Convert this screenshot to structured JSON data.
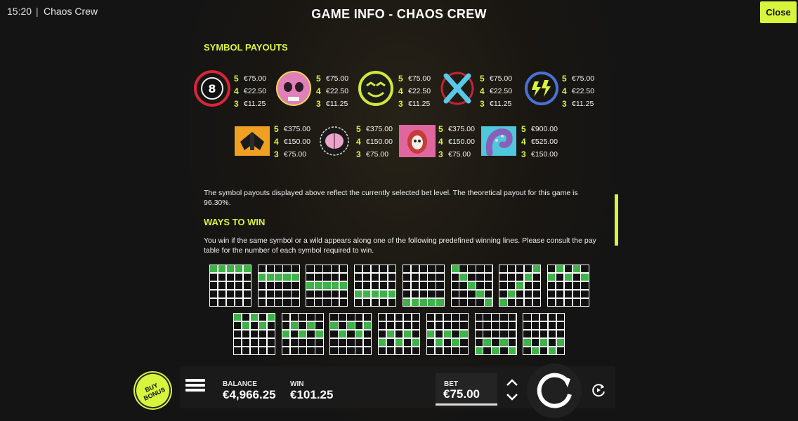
{
  "status": {
    "time": "15:20",
    "separator": "|",
    "app_name": "Chaos Crew"
  },
  "header": {
    "title": "GAME INFO - CHAOS CREW",
    "close_label": "Close"
  },
  "symbol_payouts": {
    "heading": "SYMBOL PAYOUTS",
    "row1": [
      {
        "icon": "record-disc-icon",
        "pays": [
          [
            "5",
            "€75.00"
          ],
          [
            "4",
            "€22.50"
          ],
          [
            "3",
            "€11.25"
          ]
        ]
      },
      {
        "icon": "pink-skull-icon",
        "pays": [
          [
            "5",
            "€75.00"
          ],
          [
            "4",
            "€22.50"
          ],
          [
            "3",
            "€11.25"
          ]
        ]
      },
      {
        "icon": "green-face-icon",
        "pays": [
          [
            "5",
            "€75.00"
          ],
          [
            "4",
            "€22.50"
          ],
          [
            "3",
            "€11.25"
          ]
        ]
      },
      {
        "icon": "blue-x-icon",
        "pays": [
          [
            "5",
            "€75.00"
          ],
          [
            "4",
            "€22.50"
          ],
          [
            "3",
            "€11.25"
          ]
        ]
      },
      {
        "icon": "lightning-icon",
        "pays": [
          [
            "5",
            "€75.00"
          ],
          [
            "4",
            "€22.50"
          ],
          [
            "3",
            "€11.25"
          ]
        ]
      }
    ],
    "row2": [
      {
        "icon": "moth-icon",
        "pays": [
          [
            "5",
            "€375.00"
          ],
          [
            "4",
            "€150.00"
          ],
          [
            "3",
            "€75.00"
          ]
        ]
      },
      {
        "icon": "brain-icon",
        "pays": [
          [
            "5",
            "€375.00"
          ],
          [
            "4",
            "€150.00"
          ],
          [
            "3",
            "€75.00"
          ]
        ]
      },
      {
        "icon": "apple-skull-icon",
        "pays": [
          [
            "5",
            "€375.00"
          ],
          [
            "4",
            "€150.00"
          ],
          [
            "3",
            "€75.00"
          ]
        ]
      },
      {
        "icon": "tentacle-icon",
        "pays": [
          [
            "5",
            "€900.00"
          ],
          [
            "4",
            "€525.00"
          ],
          [
            "3",
            "€150.00"
          ]
        ]
      }
    ],
    "note": "The symbol payouts displayed above reflect the currently selected bet level. The theoretical payout for this game is 96.30%."
  },
  "ways_to_win": {
    "heading": "WAYS TO WIN",
    "text": "You win if the same symbol or a wild appears along one of the following predefined winning lines. Please consult the pay table for the number of each symbol required to win.",
    "lines": [
      [
        0,
        0,
        0,
        0,
        0
      ],
      [
        1,
        1,
        1,
        1,
        1
      ],
      [
        2,
        2,
        2,
        2,
        2
      ],
      [
        3,
        3,
        3,
        3,
        3
      ],
      [
        4,
        4,
        4,
        4,
        4
      ],
      [
        0,
        1,
        2,
        3,
        4
      ],
      [
        4,
        3,
        2,
        1,
        0
      ],
      [
        1,
        0,
        1,
        0,
        1
      ],
      [
        0,
        1,
        0,
        1,
        0
      ],
      [
        2,
        1,
        2,
        1,
        2
      ],
      [
        1,
        2,
        1,
        2,
        1
      ],
      [
        3,
        2,
        3,
        2,
        3
      ],
      [
        2,
        3,
        2,
        3,
        2
      ],
      [
        4,
        3,
        4,
        3,
        4
      ],
      [
        3,
        4,
        3,
        4,
        3
      ]
    ]
  },
  "bottom": {
    "buy_bonus": "BUY BONUS",
    "balance_label": "BALANCE",
    "balance_value": "€4,966.25",
    "win_label": "WIN",
    "win_value": "€101.25",
    "bet_label": "BET",
    "bet_value": "€75.00"
  },
  "colors": {
    "accent": "#d7f53c",
    "line_cell": "#3fb24a"
  }
}
